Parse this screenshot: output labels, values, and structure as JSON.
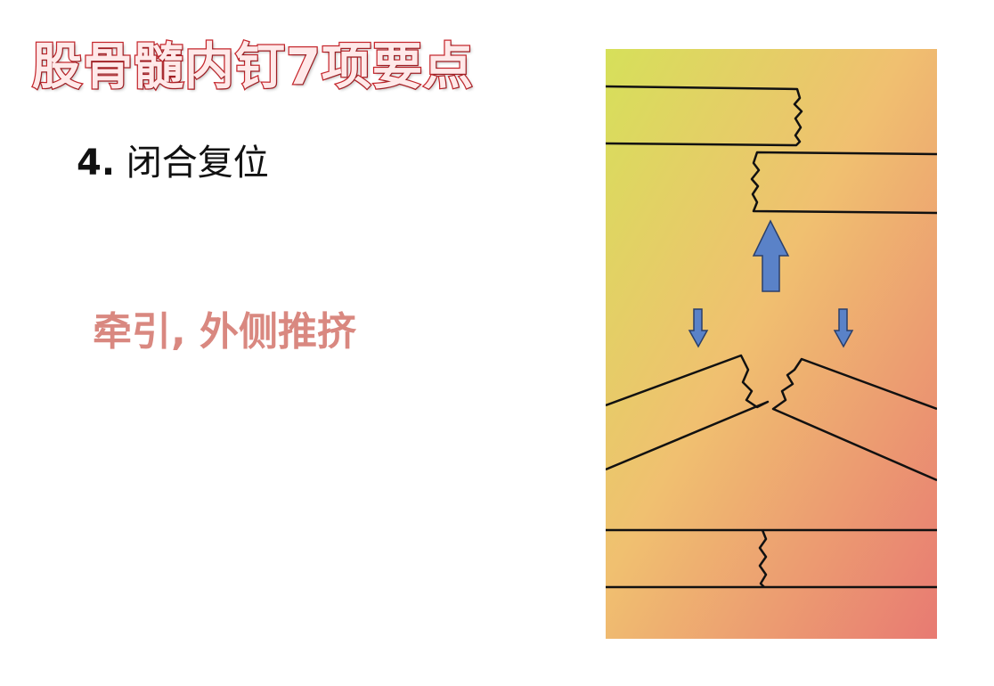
{
  "slide": {
    "title": "股骨髓内钉7项要点",
    "step": {
      "number": "4.",
      "text": "闭合复位"
    },
    "method": "牵引, 外侧推挤"
  },
  "diagram": {
    "gradient_colors": [
      "#d6e05a",
      "#f0c070",
      "#e87a72"
    ],
    "arrow_color": "#5a82c8",
    "line_color": "#111111",
    "icons": [
      "arrow-up-icon",
      "arrow-down-icon"
    ]
  }
}
